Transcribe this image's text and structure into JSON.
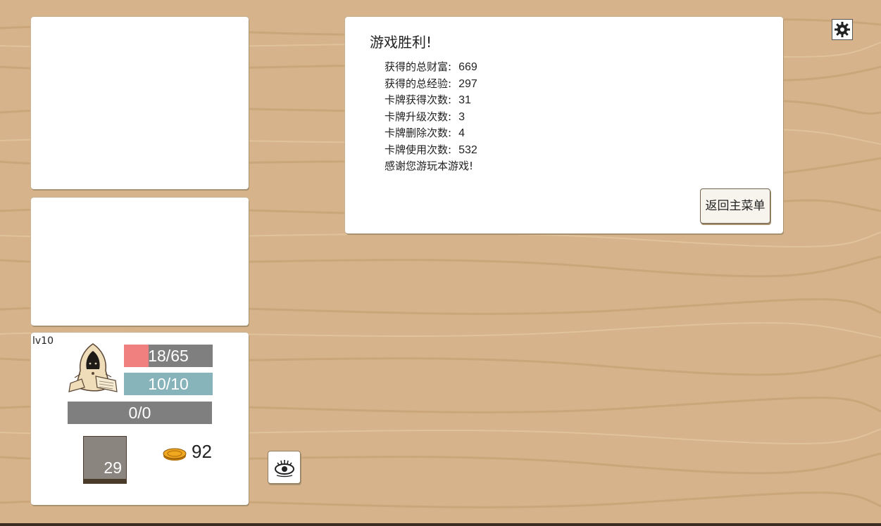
{
  "colors": {
    "background": "#d6b38a",
    "hp": "#f08080",
    "mp": "#87b3ba",
    "bar_bg": "#7f7f7f",
    "panel": "#ffffff"
  },
  "player": {
    "level": "lv10",
    "hp": {
      "text": "18/65",
      "current": 18,
      "max": 65
    },
    "mp": {
      "text": "10/10",
      "current": 10,
      "max": 10
    },
    "xp": {
      "text": "0/0",
      "current": 0,
      "max": 0
    },
    "deck_count": "29",
    "gold": "92",
    "portrait_icon": "hooded-mage-portrait"
  },
  "victory": {
    "title": "游戏胜利!",
    "stats": [
      {
        "label": "获得的总财富:",
        "value": "669"
      },
      {
        "label": "获得的总经验:",
        "value": "297"
      },
      {
        "label": "卡牌获得次数:",
        "value": "31"
      },
      {
        "label": "卡牌升级次数:",
        "value": "3"
      },
      {
        "label": "卡牌删除次数:",
        "value": "4"
      },
      {
        "label": "卡牌使用次数:",
        "value": "532"
      }
    ],
    "thanks": "感谢您游玩本游戏!",
    "back_button": "返回主菜单"
  },
  "icons": {
    "settings": "gear-icon",
    "view": "eye-icon",
    "currency": "coin-icon"
  }
}
